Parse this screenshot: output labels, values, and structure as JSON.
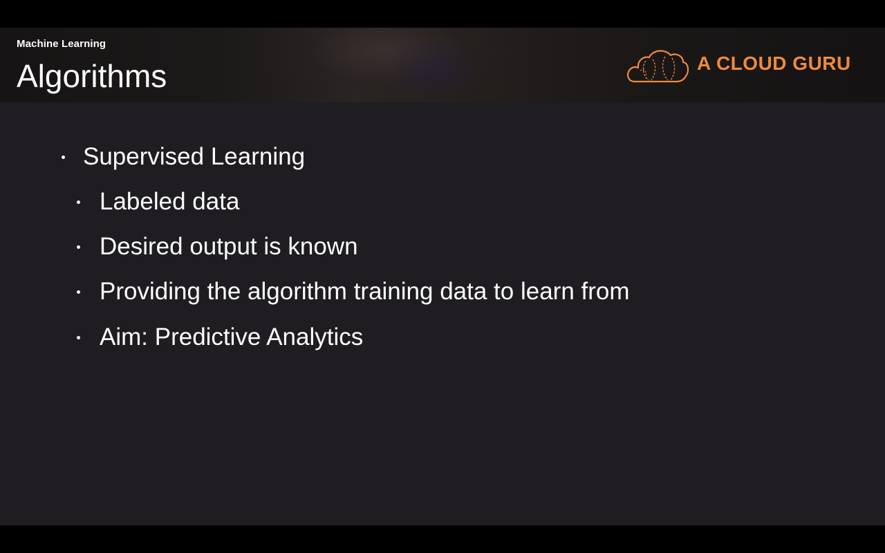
{
  "slide": {
    "subtitle": "Machine Learning",
    "title": "Algorithms",
    "logo": {
      "text": "A CLOUD GURU",
      "icon": "cloud-logo-icon",
      "color": "#f08a3c"
    },
    "bullets": [
      {
        "level": 1,
        "text": "Supervised Learning"
      },
      {
        "level": 2,
        "text": "Labeled data"
      },
      {
        "level": 2,
        "text": "Desired output is known"
      },
      {
        "level": 2,
        "text": "Providing the algorithm training data to learn from"
      },
      {
        "level": 2,
        "text": "Aim: Predictive Analytics"
      }
    ]
  },
  "colors": {
    "background": "#1f1d21",
    "text": "#ffffff",
    "accent": "#f08a3c"
  }
}
